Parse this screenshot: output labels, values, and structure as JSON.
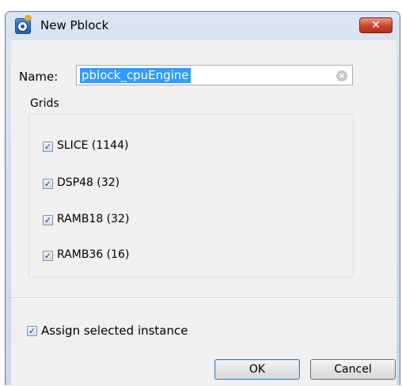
{
  "window": {
    "title": "New Pblock",
    "app_icon": "vivado-app-icon",
    "close_glyph": "✕"
  },
  "form": {
    "name_label": "Name:",
    "name_value": "pblock_cpuEngine",
    "clear_glyph": "×"
  },
  "grids": {
    "label": "Grids",
    "items": [
      {
        "label": "SLICE (1144)",
        "checked": true
      },
      {
        "label": "DSP48 (32)",
        "checked": true
      },
      {
        "label": "RAMB18 (32)",
        "checked": true
      },
      {
        "label": "RAMB36 (16)",
        "checked": true
      }
    ]
  },
  "assign": {
    "label": "Assign selected instance",
    "checked": true
  },
  "buttons": {
    "ok": "OK",
    "cancel": "Cancel"
  },
  "check_glyph": "✓"
}
